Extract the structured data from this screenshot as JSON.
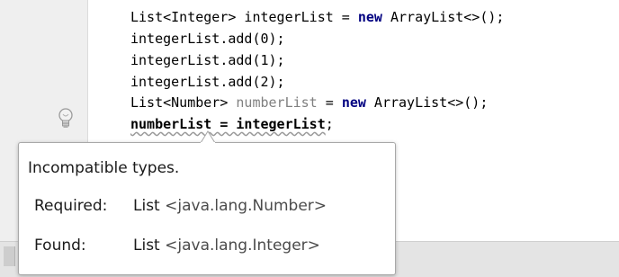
{
  "editor": {
    "lines": [
      {
        "segments": [
          {
            "t": "List<Integer> integerList = ",
            "c": ""
          },
          {
            "t": "new",
            "c": "kw"
          },
          {
            "t": " ArrayList<>();",
            "c": ""
          }
        ]
      },
      {
        "segments": [
          {
            "t": "integerList.add(0);",
            "c": ""
          }
        ]
      },
      {
        "segments": [
          {
            "t": "integerList.add(1);",
            "c": ""
          }
        ]
      },
      {
        "segments": [
          {
            "t": "integerList.add(2);",
            "c": ""
          }
        ]
      },
      {
        "segments": [
          {
            "t": "List<Number> ",
            "c": ""
          },
          {
            "t": "numberList",
            "c": "unused"
          },
          {
            "t": " = ",
            "c": ""
          },
          {
            "t": "new",
            "c": "kw"
          },
          {
            "t": " ArrayList<>();",
            "c": ""
          }
        ]
      },
      {
        "segments": [
          {
            "t": "numberList = integerList",
            "c": "err"
          },
          {
            "t": ";",
            "c": ""
          }
        ]
      }
    ]
  },
  "gutter": {
    "icon": "lightbulb-icon"
  },
  "tooltip": {
    "title": "Incompatible types.",
    "required_label": "Required:",
    "required_type": "List",
    "required_param": "<java.lang.Number>",
    "found_label": "Found:",
    "found_type": "List",
    "found_param": "<java.lang.Integer>"
  },
  "colors": {
    "keyword": "#000080",
    "unused": "#808080",
    "gutter_bg": "#efefef"
  }
}
